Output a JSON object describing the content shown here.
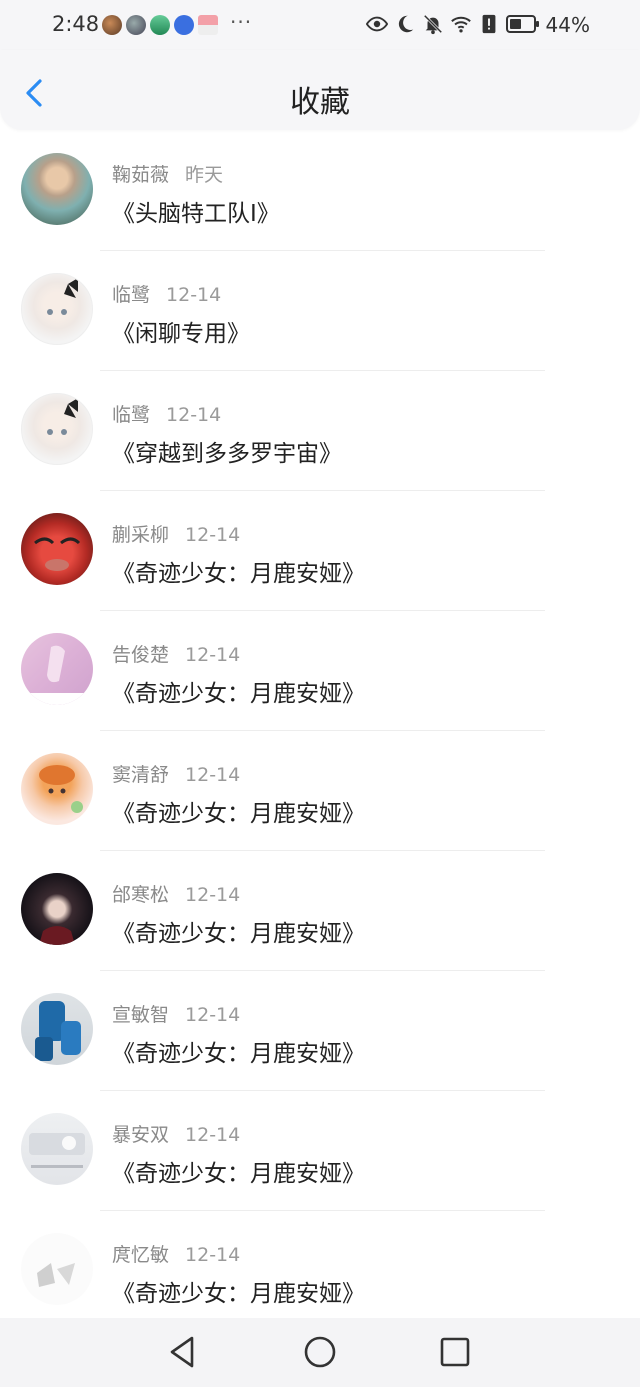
{
  "status": {
    "time": "2:48",
    "more": "···",
    "battery": "44%"
  },
  "header": {
    "title": "收藏"
  },
  "colors": {
    "accent": "#2b8cf3",
    "bg_header": "#f6f6f8"
  },
  "favorites": [
    {
      "author": "鞠茹薇",
      "date": "昨天",
      "title": "《头脑特工队I》",
      "avatar": "photo-woman"
    },
    {
      "author": "临鹭",
      "date": "12-14",
      "title": "《闲聊专用》",
      "avatar": "anime-girl-white-hair"
    },
    {
      "author": "临鹭",
      "date": "12-14",
      "title": "《穿越到多多罗宇宙》",
      "avatar": "anime-girl-white-hair"
    },
    {
      "author": "蒯采柳",
      "date": "12-14",
      "title": "《奇迹少女：月鹿安娅》",
      "avatar": "cartoon-red-face"
    },
    {
      "author": "告俊楚",
      "date": "12-14",
      "title": "《奇迹少女：月鹿安娅》",
      "avatar": "pink-pastel"
    },
    {
      "author": "窦清舒",
      "date": "12-14",
      "title": "《奇迹少女：月鹿安娅》",
      "avatar": "chibi-orange-hair"
    },
    {
      "author": "邰寒松",
      "date": "12-14",
      "title": "《奇迹少女：月鹿安娅》",
      "avatar": "dark-hair-character"
    },
    {
      "author": "宣敏智",
      "date": "12-14",
      "title": "《奇迹少女：月鹿安娅》",
      "avatar": "blue-outfit-photo"
    },
    {
      "author": "暴安双",
      "date": "12-14",
      "title": "《奇迹少女：月鹿安娅》",
      "avatar": "light-photo"
    },
    {
      "author": "庹忆敏",
      "date": "12-14",
      "title": "《奇迹少女：月鹿安娅》",
      "avatar": "white-photo"
    }
  ],
  "nav": {
    "back": "back-triangle-icon",
    "home": "home-circle-icon",
    "recents": "recents-square-icon"
  }
}
